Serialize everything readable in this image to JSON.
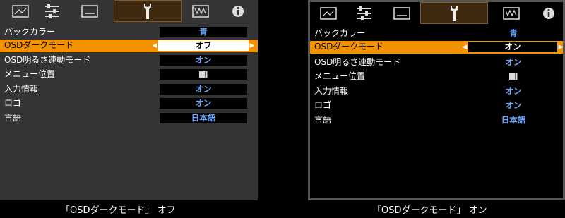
{
  "tabs": [
    "picture-icon",
    "adjust-icon",
    "screen-icon",
    "wrench-icon",
    "network-icon",
    "info-icon"
  ],
  "panels": [
    {
      "rows": [
        {
          "label": "バックカラー",
          "value": "青"
        },
        {
          "label": "OSDダークモード",
          "value": "オフ",
          "selected": true
        },
        {
          "label": "OSD明るさ連動モード",
          "value": "オン"
        },
        {
          "label": "メニュー位置",
          "value": "",
          "icon": "grid-icon"
        },
        {
          "label": "入力情報",
          "value": "オン"
        },
        {
          "label": "ロゴ",
          "value": "オン"
        },
        {
          "label": "言語",
          "value": "日本語"
        }
      ],
      "caption": "「OSDダークモード」 オフ"
    },
    {
      "rows": [
        {
          "label": "バックカラー",
          "value": "青"
        },
        {
          "label": "OSDダークモード",
          "value": "オン",
          "selected": true
        },
        {
          "label": "OSD明るさ連動モード",
          "value": "オン"
        },
        {
          "label": "メニュー位置",
          "value": "",
          "icon": "grid-icon"
        },
        {
          "label": "入力情報",
          "value": "オン"
        },
        {
          "label": "ロゴ",
          "value": "オン"
        },
        {
          "label": "言語",
          "value": "日本語"
        }
      ],
      "caption": "「OSDダークモード」 オン"
    }
  ],
  "colors": {
    "highlight": "#f39200",
    "value_text": "#6fa8ff",
    "active_tab": "#3f2a0f"
  }
}
